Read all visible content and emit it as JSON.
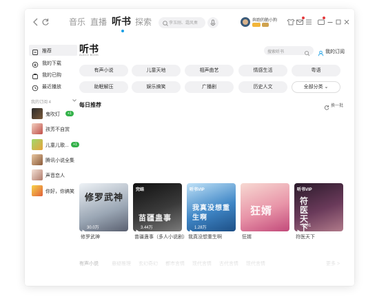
{
  "topbar": {
    "tabs": [
      {
        "label": "音乐"
      },
      {
        "label": "直播"
      },
      {
        "label": "听书"
      },
      {
        "label": "探索"
      }
    ],
    "search_placeholder": "李玉刚、霜风奏",
    "user_name": "奔跑的脆小狗"
  },
  "sidebar": {
    "items": [
      {
        "label": "推荐"
      },
      {
        "label": "我的下载"
      },
      {
        "label": "我的已购"
      },
      {
        "label": "最近播放"
      }
    ],
    "section_label": "我的订阅 4",
    "subscriptions": [
      {
        "label": "鬼吹灯",
        "badge": "+1"
      },
      {
        "label": "孩芳不自赏",
        "badge": ""
      },
      {
        "label": "儿童儿歌...",
        "badge": "+1"
      },
      {
        "label": "腾讯小说全集",
        "badge": ""
      },
      {
        "label": "声音恋人",
        "badge": ""
      },
      {
        "label": "你好，你搞笑",
        "badge": ""
      }
    ]
  },
  "main": {
    "title": "听书",
    "subtitle": "AUDIO BOOK",
    "search_placeholder": "搜索听书",
    "my_subscriptions": "我的订阅",
    "categories": [
      {
        "label": "有声小说"
      },
      {
        "label": "儿童天地"
      },
      {
        "label": "相声曲艺"
      },
      {
        "label": "情感生活"
      },
      {
        "label": "粤语"
      },
      {
        "label": "助眠解压"
      },
      {
        "label": "娱乐搞笑"
      },
      {
        "label": "广播剧"
      },
      {
        "label": "历史人文"
      },
      {
        "label": "全部分类 ⌄"
      }
    ],
    "daily_title": "每日推荐",
    "refresh_label": "换一批",
    "books": [
      {
        "title": "修罗武神",
        "plays": "30.0万",
        "corner": "",
        "art": "修罗武神",
        "color_a": "#dfe6ee",
        "color_b": "#7f8a98"
      },
      {
        "title": "苗疆蛊事（多人小说剧）",
        "plays": "3.44万",
        "corner": "完结",
        "art": "苗疆蛊事",
        "color_a": "#2a2a2a",
        "color_b": "#6a6a6a"
      },
      {
        "title": "我真没想重生啊",
        "plays": "1.28万",
        "corner": "听书VIP",
        "art": "我真没想重生啊",
        "color_a": "#2e6fb0",
        "color_b": "#7fb4e0"
      },
      {
        "title": "狂婿",
        "plays": "",
        "corner": "",
        "art": "狂婿",
        "color_a": "#e48a9a",
        "color_b": "#c94a7a"
      },
      {
        "title": "符医天下",
        "plays": "5301",
        "corner": "听书VIP",
        "art": "符医天下",
        "color_a": "#5a3a5a",
        "color_b": "#a36a8a"
      }
    ],
    "bottom_row": [
      {
        "label": "有声小说"
      },
      {
        "label": "悬疑推理"
      },
      {
        "label": "玄幻奇幻"
      },
      {
        "label": "都市言情"
      },
      {
        "label": "现代言情"
      },
      {
        "label": "古代言情"
      },
      {
        "label": "现代言情"
      },
      {
        "label": "更多 >"
      }
    ]
  },
  "colors": {
    "accent": "#1a9fe5",
    "badge_green": "#34b24a",
    "red_dot": "#e4393c"
  }
}
